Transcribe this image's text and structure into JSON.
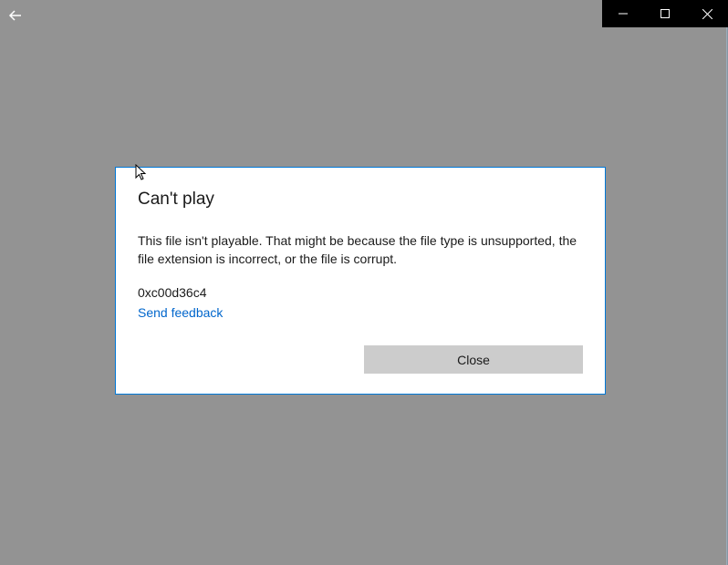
{
  "dialog": {
    "title": "Can't play",
    "message": "This file isn't playable. That might be because the file type is unsupported, the file extension is incorrect, or the file is corrupt.",
    "error_code": "0xc00d36c4",
    "feedback_link": "Send feedback",
    "close_label": "Close"
  }
}
